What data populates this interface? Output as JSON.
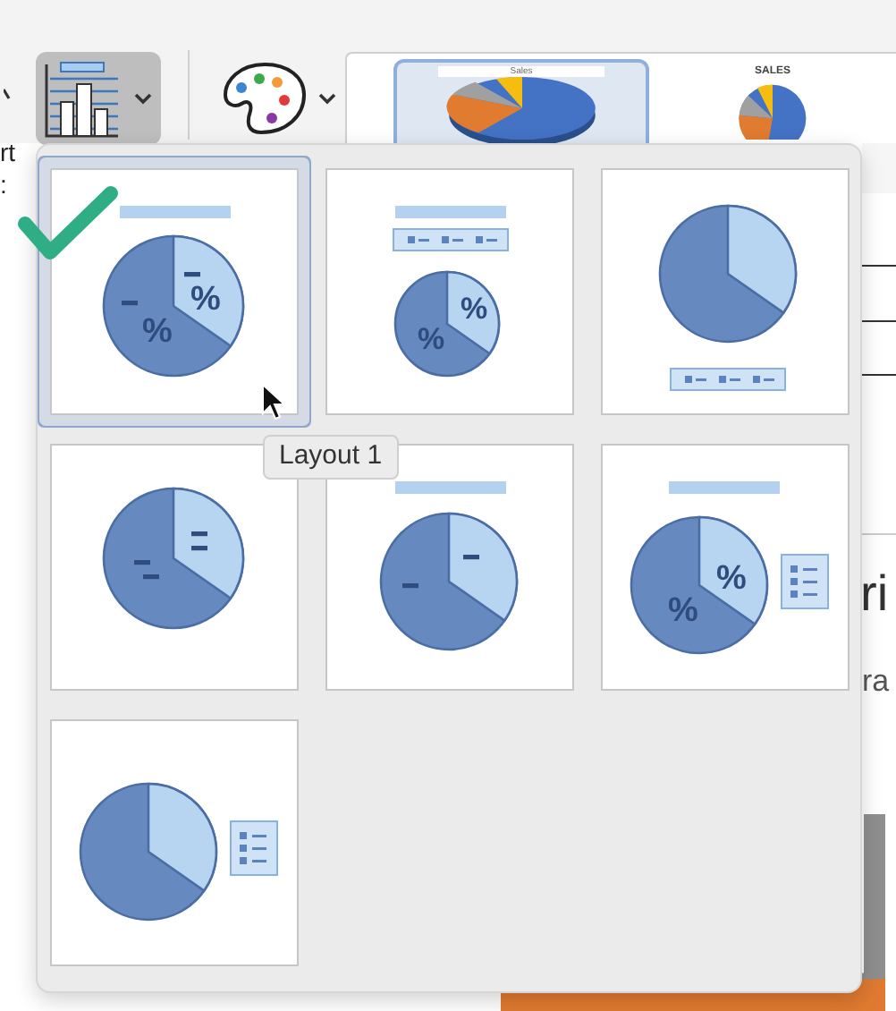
{
  "ribbon": {
    "left_label": "rt",
    "left_label_2": ":",
    "chart_styles": [
      {
        "title": "Sales",
        "selected": true
      },
      {
        "title": "SALES",
        "selected": false
      }
    ]
  },
  "document": {
    "heading_fragment": "ri",
    "text_fragment": "ra"
  },
  "layouts": [
    {
      "kind": "title-callouts",
      "selected": true,
      "labels": [
        "%",
        "%"
      ]
    },
    {
      "kind": "title-legend-top",
      "selected": false,
      "labels": [
        "%",
        "%"
      ]
    },
    {
      "kind": "legend-bottom",
      "selected": false
    },
    {
      "kind": "callouts",
      "selected": false
    },
    {
      "kind": "title-leaders",
      "selected": false
    },
    {
      "kind": "title-legend-right",
      "selected": false,
      "labels": [
        "%",
        "%"
      ]
    },
    {
      "kind": "legend-right",
      "selected": false
    }
  ],
  "tooltip": "Layout 1"
}
